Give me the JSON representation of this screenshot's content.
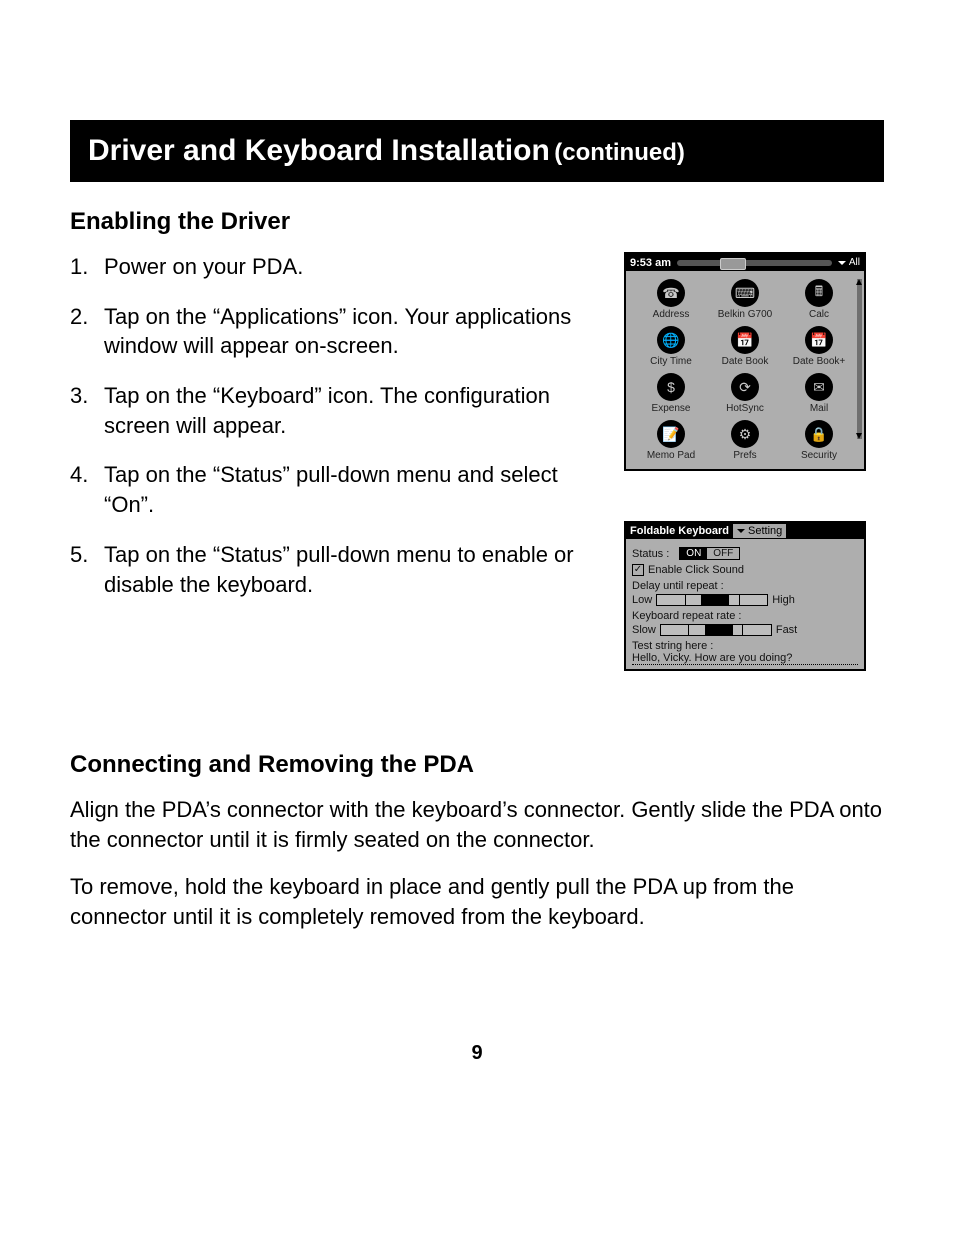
{
  "header": {
    "title": "Driver and Keyboard Installation",
    "continued": "(continued)"
  },
  "section1": {
    "heading": "Enabling the Driver",
    "steps": [
      "Power on your PDA.",
      "Tap on the “Applications” icon. Your applications window will appear on-screen.",
      "Tap on the “Keyboard” icon. The configuration screen will appear.",
      "Tap on the “Status” pull-down menu and select “On”.",
      "Tap on the “Status” pull-down menu to enable or disable the keyboard."
    ]
  },
  "section2": {
    "heading": "Connecting and Removing the PDA",
    "paragraphs": [
      "Align the PDA’s connector with the keyboard’s connector. Gently slide the PDA onto the connector until it is firmly seated on the connector.",
      "To remove, hold the keyboard in place and gently pull the PDA up from the connector until it is completely removed from the keyboard."
    ]
  },
  "pdaLauncher": {
    "time": "9:53 am",
    "category": "All",
    "apps": [
      {
        "label": "Address"
      },
      {
        "label": "Belkin G700"
      },
      {
        "label": "Calc"
      },
      {
        "label": "City Time"
      },
      {
        "label": "Date Book"
      },
      {
        "label": "Date Book+"
      },
      {
        "label": "Expense"
      },
      {
        "label": "HotSync"
      },
      {
        "label": "Mail"
      },
      {
        "label": "Memo Pad"
      },
      {
        "label": "Prefs"
      },
      {
        "label": "Security"
      }
    ]
  },
  "pdaConfig": {
    "title": "Foldable Keyboard",
    "tab": "Setting",
    "statusLabel": "Status :",
    "statusOn": "ON",
    "statusOff": "OFF",
    "enableClickSound": "Enable Click Sound",
    "delayLabel": "Delay until repeat :",
    "delayLow": "Low",
    "delayHigh": "High",
    "rateLabel": "Keyboard repeat rate :",
    "rateSlow": "Slow",
    "rateFast": "Fast",
    "testLabel": "Test string here :",
    "testValue": "Hello, Vicky. How are you doing?"
  },
  "pageNumber": "9"
}
